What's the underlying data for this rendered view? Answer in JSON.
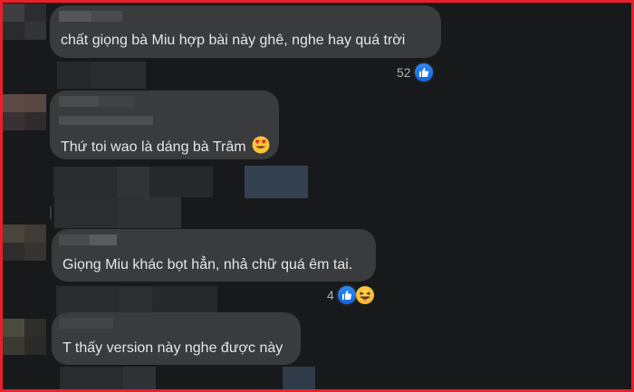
{
  "comments": [
    {
      "text": "chất giọng bà Miu hợp bài này ghê, nghe hay quá trời",
      "reaction_count": "52",
      "reactions": [
        "like-icon"
      ]
    },
    {
      "text": "Thứ toi wao là dáng bà Trâm",
      "emoji": "heart-eyes-icon"
    },
    {
      "text": "Giọng Miu khác bọt hẳn, nhả chữ quá êm tai.",
      "reaction_count": "4",
      "reactions": [
        "like-icon",
        "haha-icon"
      ]
    },
    {
      "text": "T thấy version này nghe được này"
    }
  ],
  "colors": {
    "background": "#18191a",
    "bubble": "#3a3b3c",
    "text": "#e4e6eb",
    "meta_text": "#b0b3b8",
    "frame_border": "#e8202a",
    "like_blue": "#1877f2"
  }
}
